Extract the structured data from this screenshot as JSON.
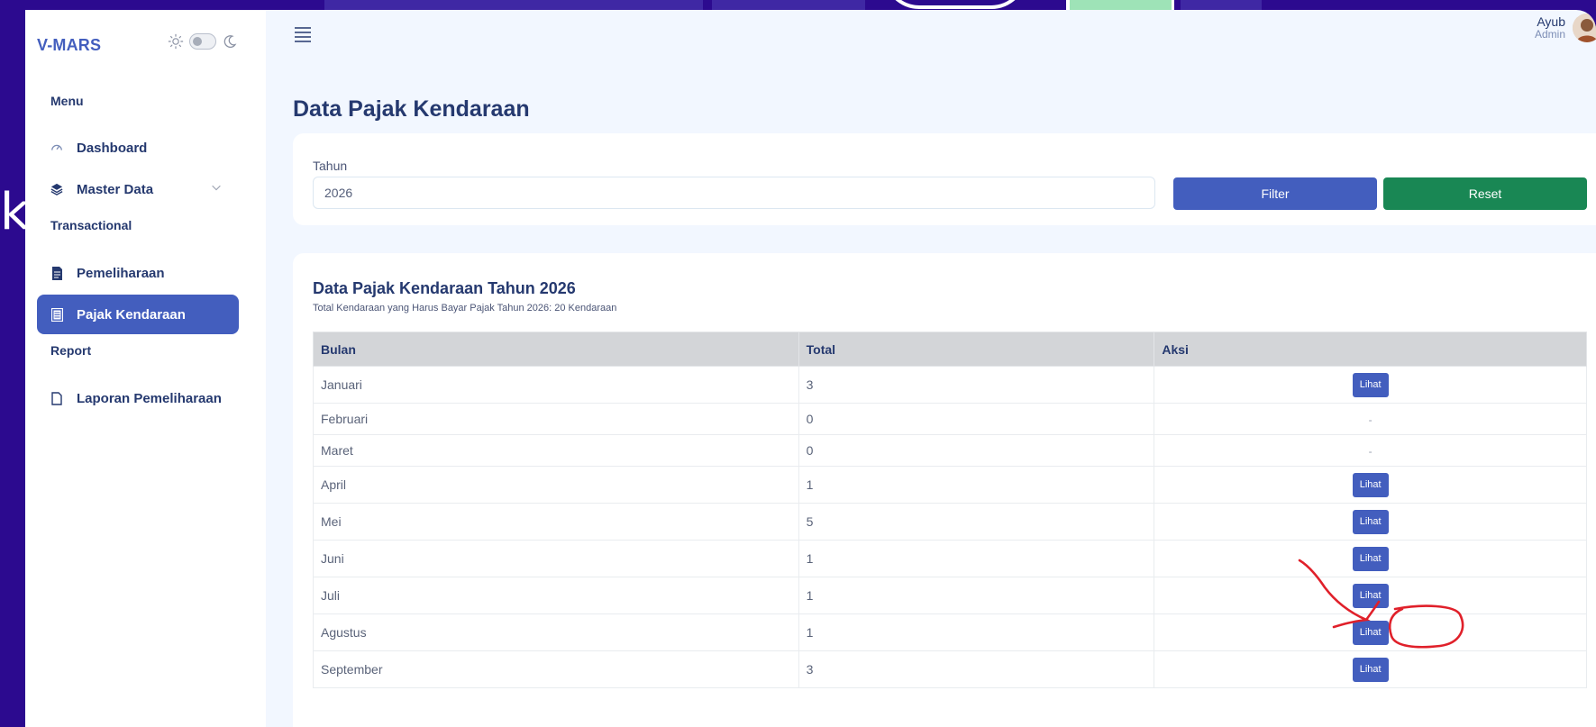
{
  "brand": "V-MARS",
  "backdrop_letter": "k",
  "user": {
    "name": "Ayub",
    "role": "Admin"
  },
  "sidebar": {
    "sections": [
      "Menu",
      "Transactional",
      "Report"
    ],
    "items": [
      {
        "label": "Dashboard",
        "icon": "speedometer-icon"
      },
      {
        "label": "Master Data",
        "icon": "stack-icon"
      },
      {
        "label": "Pemeliharaan",
        "icon": "file-text-icon"
      },
      {
        "label": "Pajak Kendaraan",
        "icon": "journal-icon",
        "active": true
      },
      {
        "label": "Laporan Pemeliharaan",
        "icon": "file-icon"
      }
    ]
  },
  "page": {
    "title": "Data Pajak Kendaraan"
  },
  "filter": {
    "label": "Tahun",
    "value": "2026",
    "filter_label": "Filter",
    "reset_label": "Reset"
  },
  "table_card": {
    "title": "Data Pajak Kendaraan Tahun 2026",
    "subtitle": "Total Kendaraan yang Harus Bayar Pajak Tahun 2026: 20 Kendaraan",
    "headers": [
      "Bulan",
      "Total",
      "Aksi"
    ],
    "rows": [
      {
        "bulan": "Januari",
        "total": "3",
        "aksi": "Lihat"
      },
      {
        "bulan": "Februari",
        "total": "0",
        "aksi": "-"
      },
      {
        "bulan": "Maret",
        "total": "0",
        "aksi": "-"
      },
      {
        "bulan": "April",
        "total": "1",
        "aksi": "Lihat"
      },
      {
        "bulan": "Mei",
        "total": "5",
        "aksi": "Lihat"
      },
      {
        "bulan": "Juni",
        "total": "1",
        "aksi": "Lihat"
      },
      {
        "bulan": "Juli",
        "total": "1",
        "aksi": "Lihat"
      },
      {
        "bulan": "Agustus",
        "total": "1",
        "aksi": "Lihat"
      },
      {
        "bulan": "September",
        "total": "3",
        "aksi": "Lihat"
      }
    ]
  },
  "colors": {
    "backdrop": "#2c0a8f",
    "primary": "#435ebe",
    "success": "#198754",
    "annotation": "#e0202a"
  }
}
